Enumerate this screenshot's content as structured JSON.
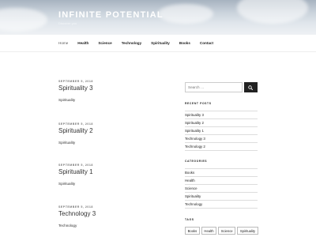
{
  "site": {
    "title": "INFINITE POTENTIAL",
    "description": "Discover you"
  },
  "nav": {
    "items": [
      {
        "label": "Home",
        "current": true
      },
      {
        "label": "Health"
      },
      {
        "label": "Science"
      },
      {
        "label": "Technology"
      },
      {
        "label": "Spirituality"
      },
      {
        "label": "Books"
      },
      {
        "label": "Contact"
      }
    ]
  },
  "posts": [
    {
      "date": "SEPTEMBER 5, 2018",
      "title": "Spirituality 3",
      "body": "Spirituality"
    },
    {
      "date": "SEPTEMBER 5, 2018",
      "title": "Spirituality 2",
      "body": "Spirituality"
    },
    {
      "date": "SEPTEMBER 5, 2018",
      "title": "Spirituality 1",
      "body": "Spirituality"
    },
    {
      "date": "SEPTEMBER 5, 2018",
      "title": "Technology 3",
      "body": "Technology"
    }
  ],
  "sidebar": {
    "search_placeholder": "Search …",
    "recent_posts": {
      "title": "RECENT POSTS",
      "items": [
        "Spirituality 3",
        "Spirituality 2",
        "Spirituality 1",
        "Technology 3",
        "Technology 2"
      ]
    },
    "categories": {
      "title": "CATEGORIES",
      "items": [
        "Books",
        "Health",
        "Science",
        "Spirituality",
        "Technology"
      ]
    },
    "tags": {
      "title": "TAGS",
      "items": [
        "Books",
        "Health",
        "Science",
        "Spirituality"
      ]
    }
  },
  "icons": {
    "search_button": "search-icon"
  },
  "colors": {
    "nav_text": "#222222",
    "date_text": "#767676",
    "search_button": "#222222"
  }
}
